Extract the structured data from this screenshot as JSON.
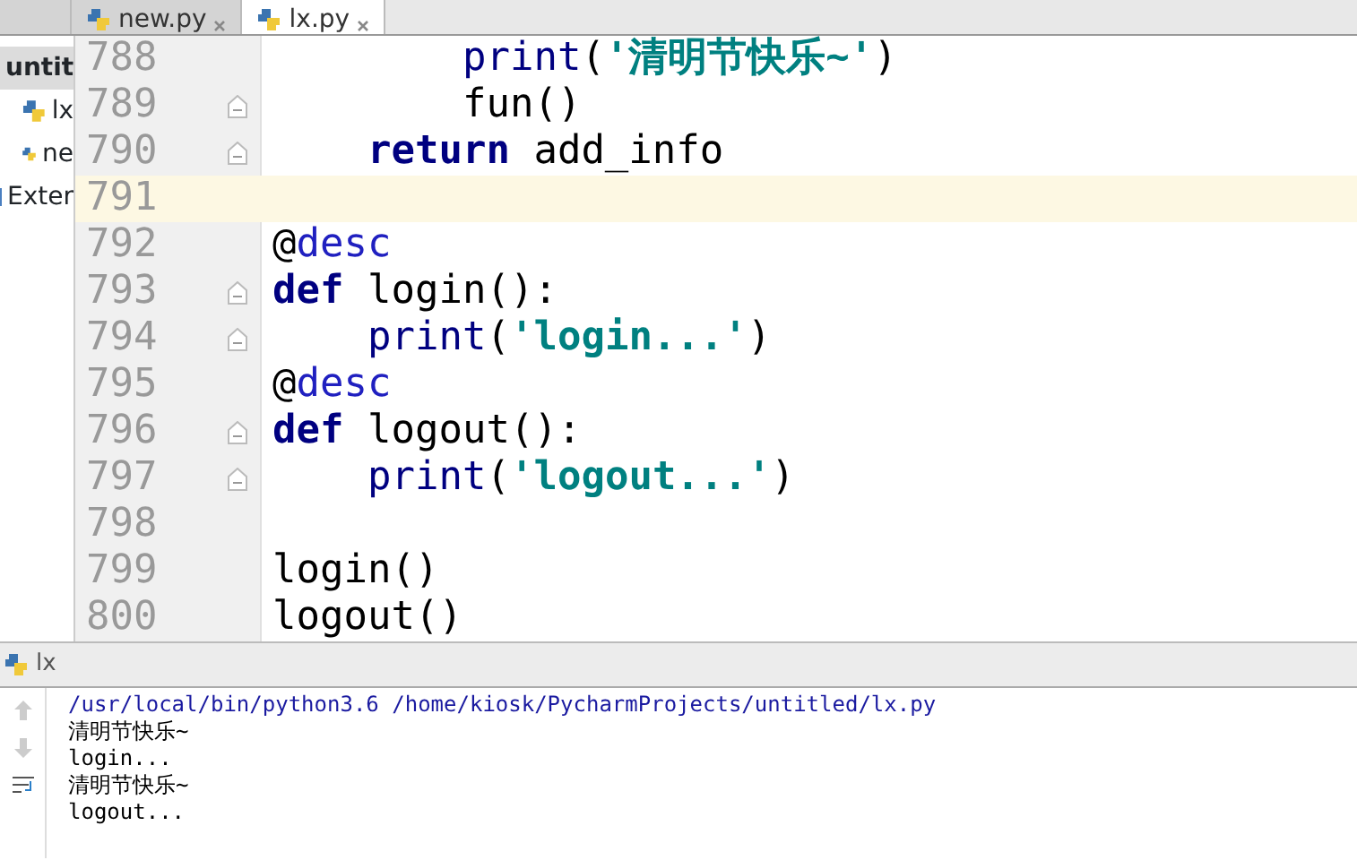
{
  "editor_tabs": [
    {
      "label": "new.py",
      "selected": false
    },
    {
      "label": "lx.py",
      "selected": true
    }
  ],
  "project_tree": [
    {
      "label": "untit",
      "kind": "folder",
      "selected": true,
      "children": [
        {
          "label": "lx",
          "kind": "python",
          "selected": false
        },
        {
          "label": "ne",
          "kind": "python",
          "selected": false
        }
      ]
    },
    {
      "label": "Exter",
      "kind": "library",
      "selected": false
    }
  ],
  "editor": {
    "lines": [
      {
        "number": "788",
        "current": false,
        "fold": false,
        "tokens": [
          {
            "kind": "builtin",
            "text": "        print"
          },
          {
            "kind": "plain",
            "text": "("
          },
          {
            "kind": "string",
            "text": "'清明节快乐~'"
          },
          {
            "kind": "plain",
            "text": ")"
          }
        ]
      },
      {
        "number": "789",
        "current": false,
        "fold": true,
        "tokens": [
          {
            "kind": "plain",
            "text": "        fun()"
          }
        ]
      },
      {
        "number": "790",
        "current": false,
        "fold": true,
        "tokens": [
          {
            "kind": "keyword",
            "text": "    return"
          },
          {
            "kind": "plain",
            "text": " add_info"
          }
        ]
      },
      {
        "number": "791",
        "current": true,
        "fold": false
      },
      {
        "number": "792",
        "current": false,
        "fold": false,
        "tokens": [
          {
            "kind": "plain",
            "text": "@"
          },
          {
            "kind": "decorator",
            "text": "desc"
          }
        ]
      },
      {
        "number": "793",
        "current": false,
        "fold": true,
        "tokens": [
          {
            "kind": "keyword",
            "text": "def"
          },
          {
            "kind": "plain",
            "text": " login():"
          }
        ]
      },
      {
        "number": "794",
        "current": false,
        "fold": true,
        "tokens": [
          {
            "kind": "builtin",
            "text": "    print"
          },
          {
            "kind": "plain",
            "text": "("
          },
          {
            "kind": "string",
            "text": "'login...'"
          },
          {
            "kind": "plain",
            "text": ")"
          }
        ]
      },
      {
        "number": "795",
        "current": false,
        "fold": false,
        "tokens": [
          {
            "kind": "plain",
            "text": "@"
          },
          {
            "kind": "decorator",
            "text": "desc"
          }
        ]
      },
      {
        "number": "796",
        "current": false,
        "fold": true,
        "tokens": [
          {
            "kind": "keyword",
            "text": "def"
          },
          {
            "kind": "plain",
            "text": " logout():"
          }
        ]
      },
      {
        "number": "797",
        "current": false,
        "fold": true,
        "tokens": [
          {
            "kind": "builtin",
            "text": "    print"
          },
          {
            "kind": "plain",
            "text": "("
          },
          {
            "kind": "string",
            "text": "'logout...'"
          },
          {
            "kind": "plain",
            "text": ")"
          }
        ]
      },
      {
        "number": "798",
        "current": false,
        "fold": false
      },
      {
        "number": "799",
        "current": false,
        "fold": false,
        "tokens": [
          {
            "kind": "plain",
            "text": "login()"
          }
        ]
      },
      {
        "number": "800",
        "current": false,
        "fold": false,
        "tokens": [
          {
            "kind": "plain",
            "text": "logout()"
          }
        ]
      }
    ]
  },
  "run_panel": {
    "title": "lx",
    "console": [
      {
        "kind": "command",
        "text": "/usr/local/bin/python3.6 /home/kiosk/PycharmProjects/untitled/lx.py"
      },
      {
        "kind": "output",
        "text": "清明节快乐~"
      },
      {
        "kind": "output",
        "text": "login..."
      },
      {
        "kind": "output",
        "text": "清明节快乐~"
      },
      {
        "kind": "output",
        "text": "logout..."
      }
    ]
  }
}
